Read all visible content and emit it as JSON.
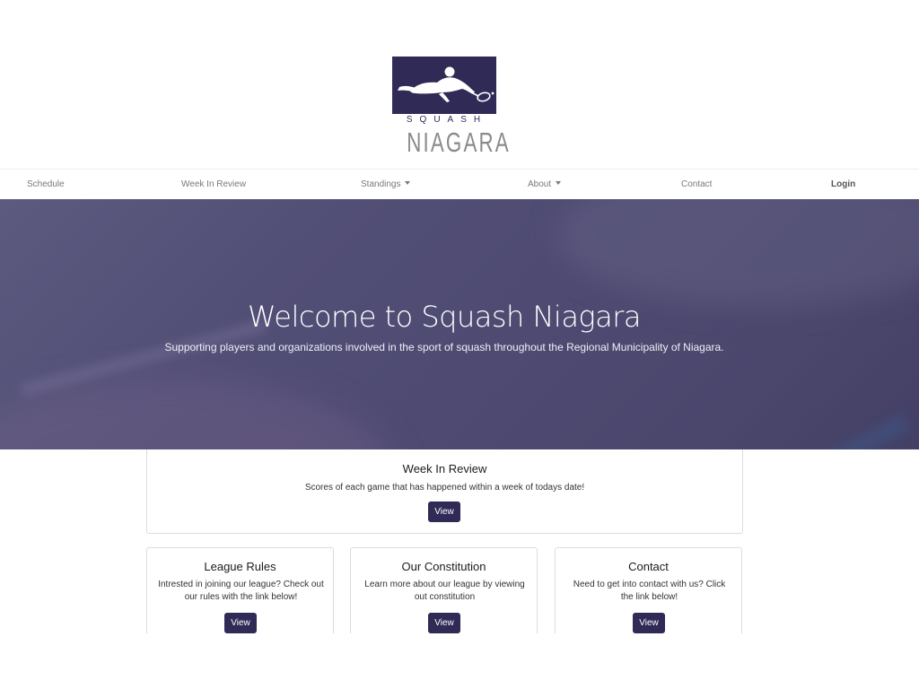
{
  "brand": {
    "logo_top": "SQUASH",
    "logo_bottom": "NIAGARA",
    "primary_color": "#2f2a56"
  },
  "nav": {
    "items": [
      {
        "label": "Schedule"
      },
      {
        "label": "Week In Review"
      },
      {
        "label": "Standings"
      },
      {
        "label": "About"
      },
      {
        "label": "Contact"
      },
      {
        "label": "Login"
      }
    ]
  },
  "hero": {
    "title": "Welcome to Squash Niagara",
    "subtitle": "Supporting players and organizations involved in the sport of squash throughout the Regional Municipality of Niagara."
  },
  "cards": {
    "week_in_review": {
      "title": "Week In Review",
      "text": "Scores of each game that has happened within a week of todays date!",
      "button": "View"
    },
    "league_rules": {
      "title": "League Rules",
      "text": "Intrested in joining our league? Check out our rules with the link below!",
      "button": "View"
    },
    "constitution": {
      "title": "Our Constitution",
      "text": "Learn more about our league by viewing out constitution",
      "button": "View"
    },
    "contact": {
      "title": "Contact",
      "text": "Need to get into contact with us? Click the link below!",
      "button": "View"
    }
  }
}
